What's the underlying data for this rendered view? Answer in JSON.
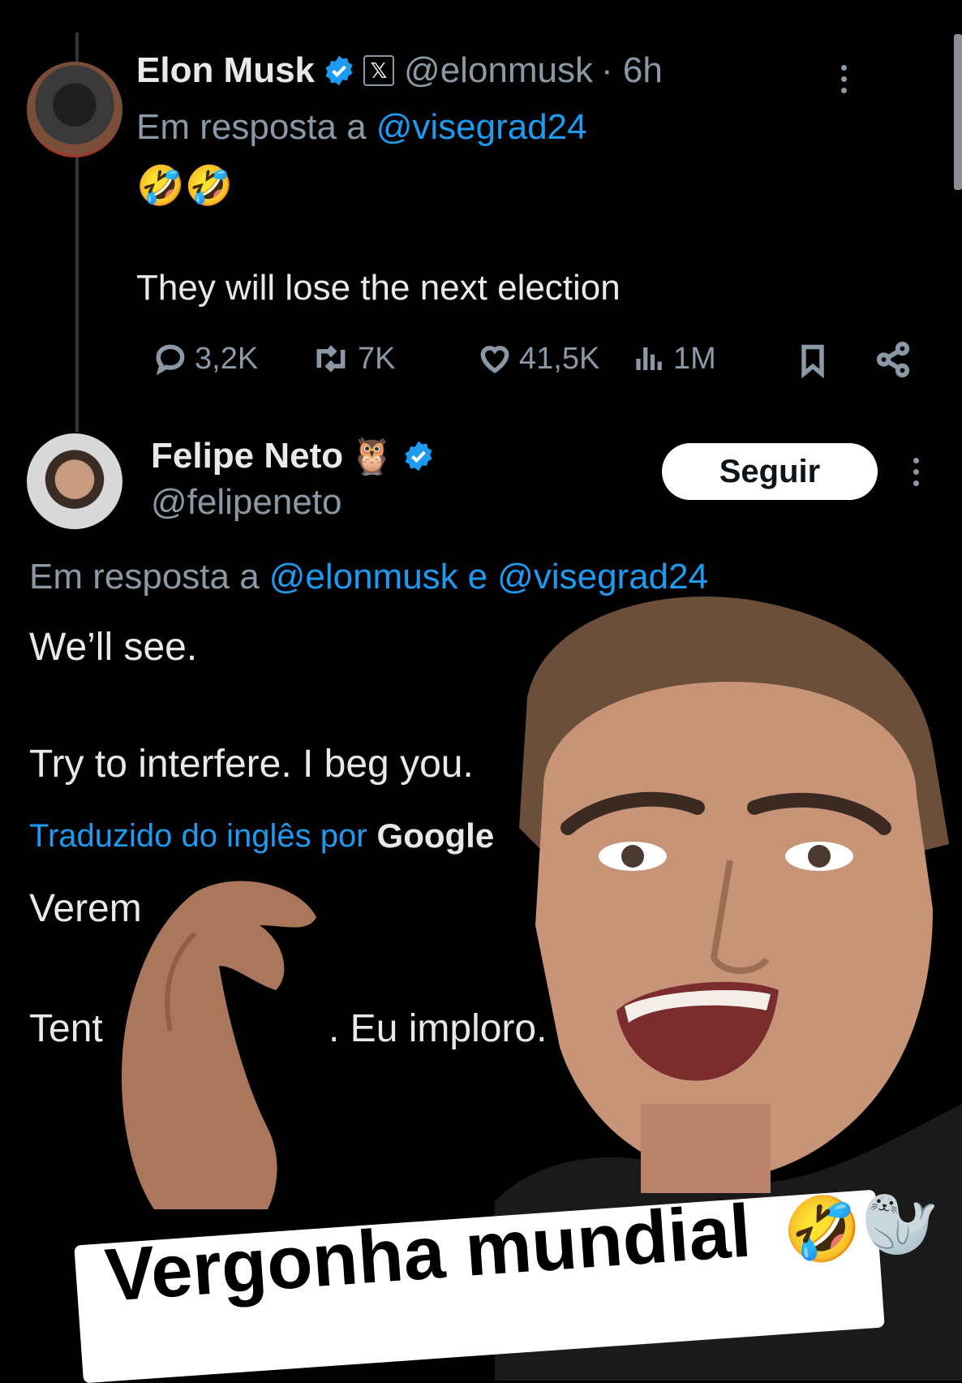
{
  "tweet1": {
    "name": "Elon Musk",
    "handle": "@elonmusk",
    "time": "· 6h",
    "reply_prefix": "Em resposta a",
    "reply_to": "@visegrad24",
    "emoji_line": "🤣🤣",
    "text": "They will lose the next election",
    "actions": {
      "replies": "3,2K",
      "reposts": "7K",
      "likes": "41,5K",
      "views": "1M"
    }
  },
  "tweet2": {
    "name": "Felipe Neto",
    "name_emoji": "🦉",
    "handle": "@felipeneto",
    "follow_label": "Seguir",
    "reply_prefix": "Em resposta a",
    "reply_to_1": "@elonmusk",
    "reply_join": "e",
    "reply_to_2": "@visegrad24",
    "text_line1": "We’ll see.",
    "text_line2": "Try to interfere. I beg you.",
    "translated_label": "Traduzido do inglês por",
    "translator": "Google",
    "translated_line1": "Verem",
    "translated_line2_a": "Tent",
    "translated_line2_b": ". Eu imploro."
  },
  "overlay": {
    "caption": "Vergonha mundial",
    "caption_emoji": "🤣🦭"
  },
  "colors": {
    "background": "#000000",
    "link": "#1d9bf0",
    "muted": "#8b98a5",
    "verified": "#1d9bf0"
  }
}
